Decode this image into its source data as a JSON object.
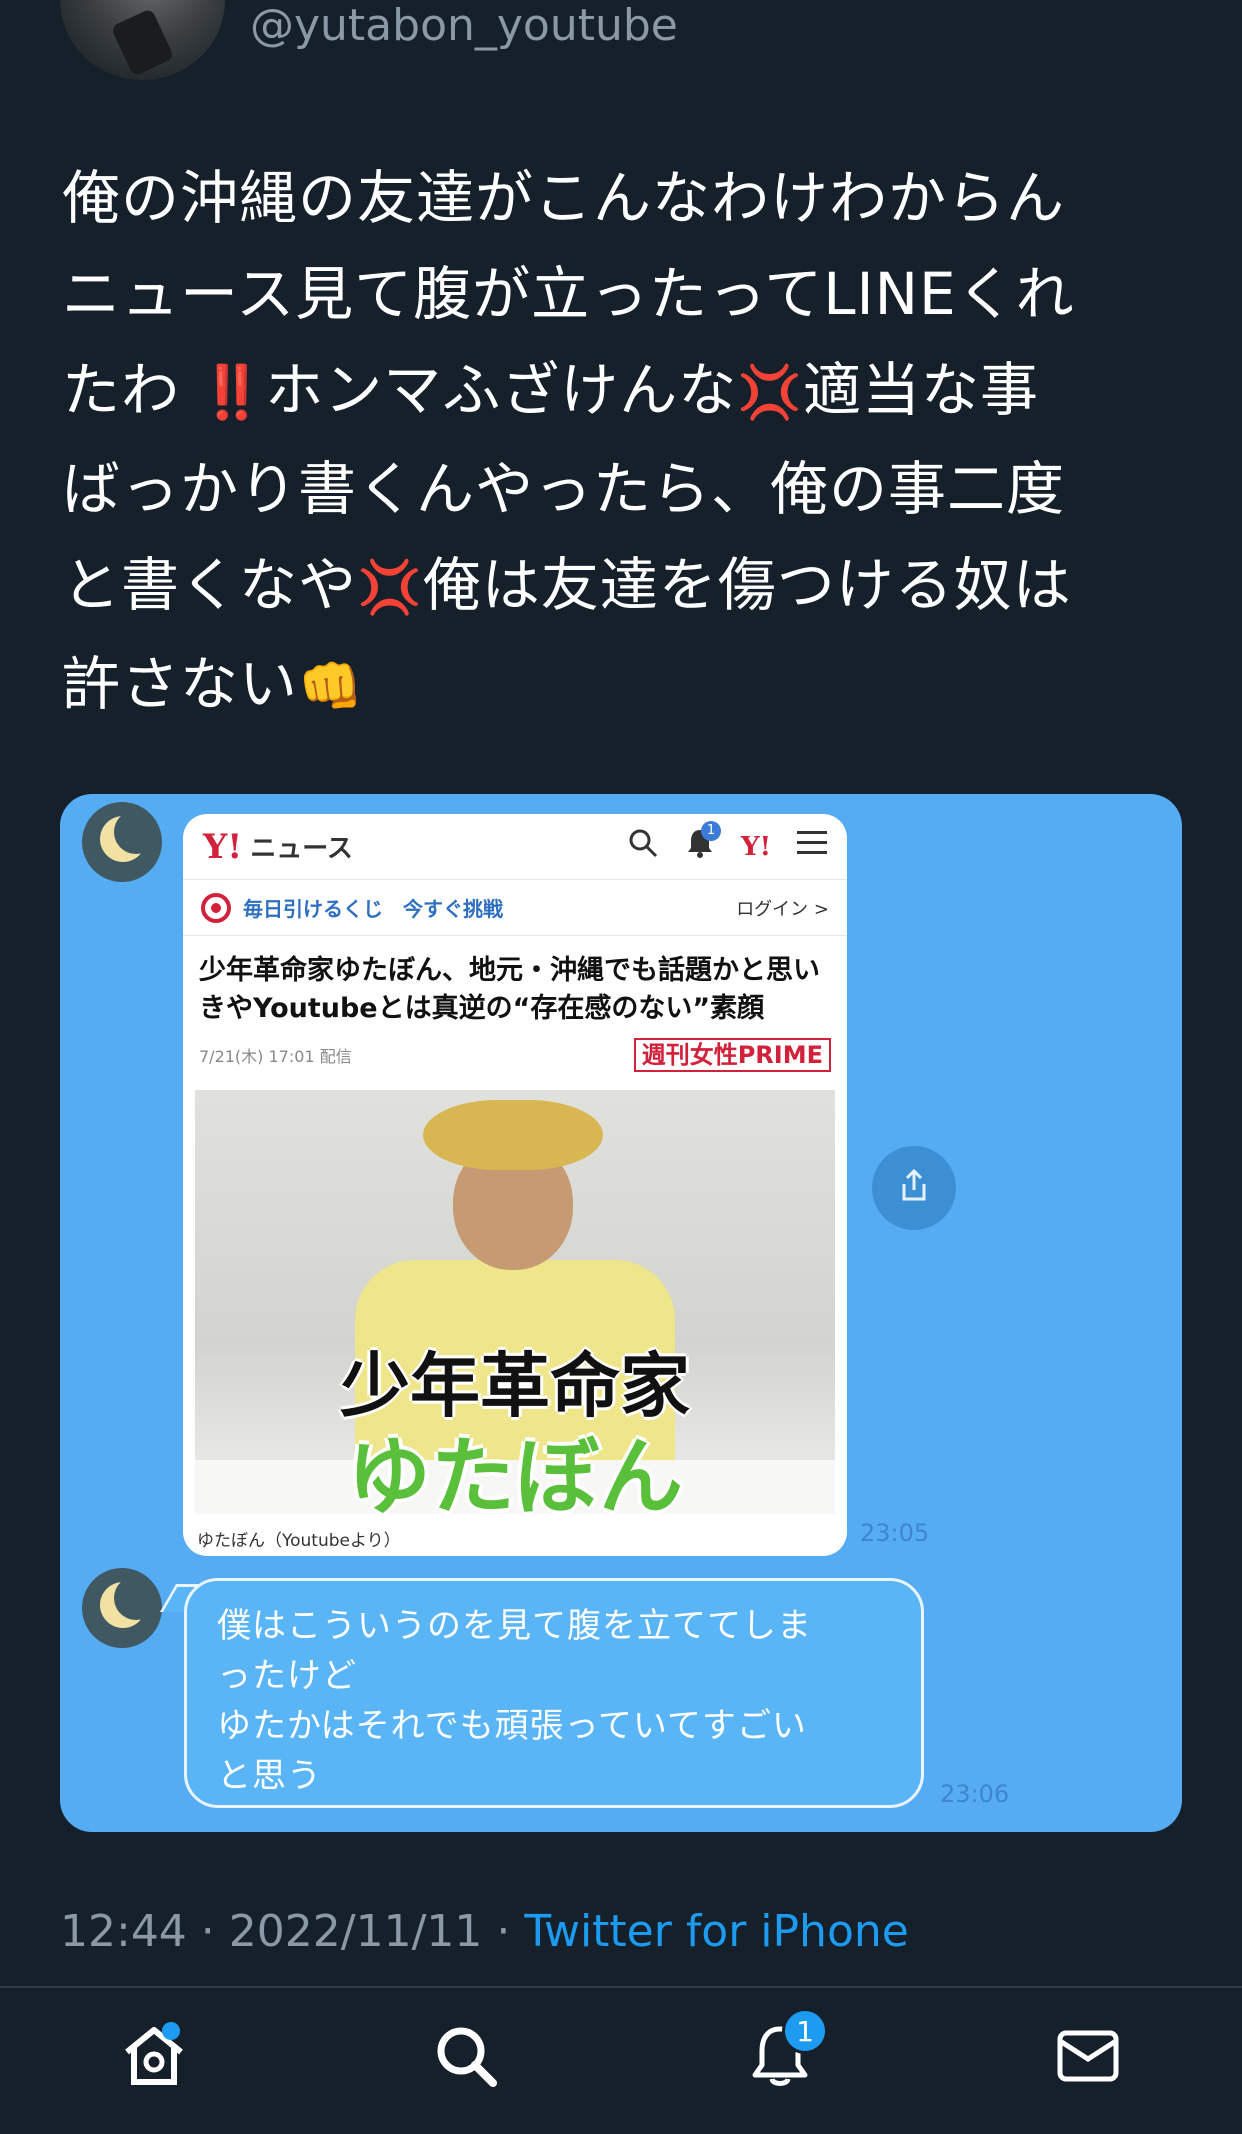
{
  "author": {
    "handle": "@yutabon_youtube"
  },
  "tweet": {
    "text_1": "俺の沖縄の友達がこんなわけわからん\nニュース見て腹が立ったってLINEくれ\nたわ ",
    "emoji_1": "‼️",
    "text_2": "ホンマふざけんな",
    "emoji_2": "💢",
    "text_3": "適当な事\nばっかり書くんやったら、俺の事二度\nと書くなや",
    "emoji_3": "💢",
    "text_4": "俺は友達を傷つける奴は\n許さない",
    "emoji_4": "👊"
  },
  "media": {
    "news_card": {
      "logo": "Y!",
      "site_title": "ニュース",
      "promo_text": "毎日引けるくじ　今すぐ挑戦",
      "login_text": "ログイン >",
      "headline": "少年革命家ゆたぼん、地元・沖縄でも話題かと思いきやYoutubeとは真逆の“存在感のない”素顔",
      "date": "7/21(木) 17:01 配信",
      "brand": "週刊女性PRIME",
      "photo_text_line1": "少年革命家",
      "photo_text_line2": "ゆたぼん",
      "caption": "ゆたぼん（Youtubeより）",
      "notification_count": "1"
    },
    "time_1": "23:05",
    "message": "僕はこういうのを見て腹を立ててしま\nったけど\nゆたかはそれでも頑張っていてすごい\nと思う",
    "time_2": "23:06"
  },
  "meta": {
    "time": "12:44",
    "separator": " · ",
    "date": "2022/11/11",
    "source": "Twitter for iPhone"
  },
  "tabbar": {
    "notification_badge": "1",
    "items": [
      "home-icon",
      "search-icon",
      "bell-icon",
      "mail-icon"
    ]
  },
  "colors": {
    "background": "#15202b",
    "accent": "#1d9bf0",
    "media_background": "#55acf3"
  }
}
